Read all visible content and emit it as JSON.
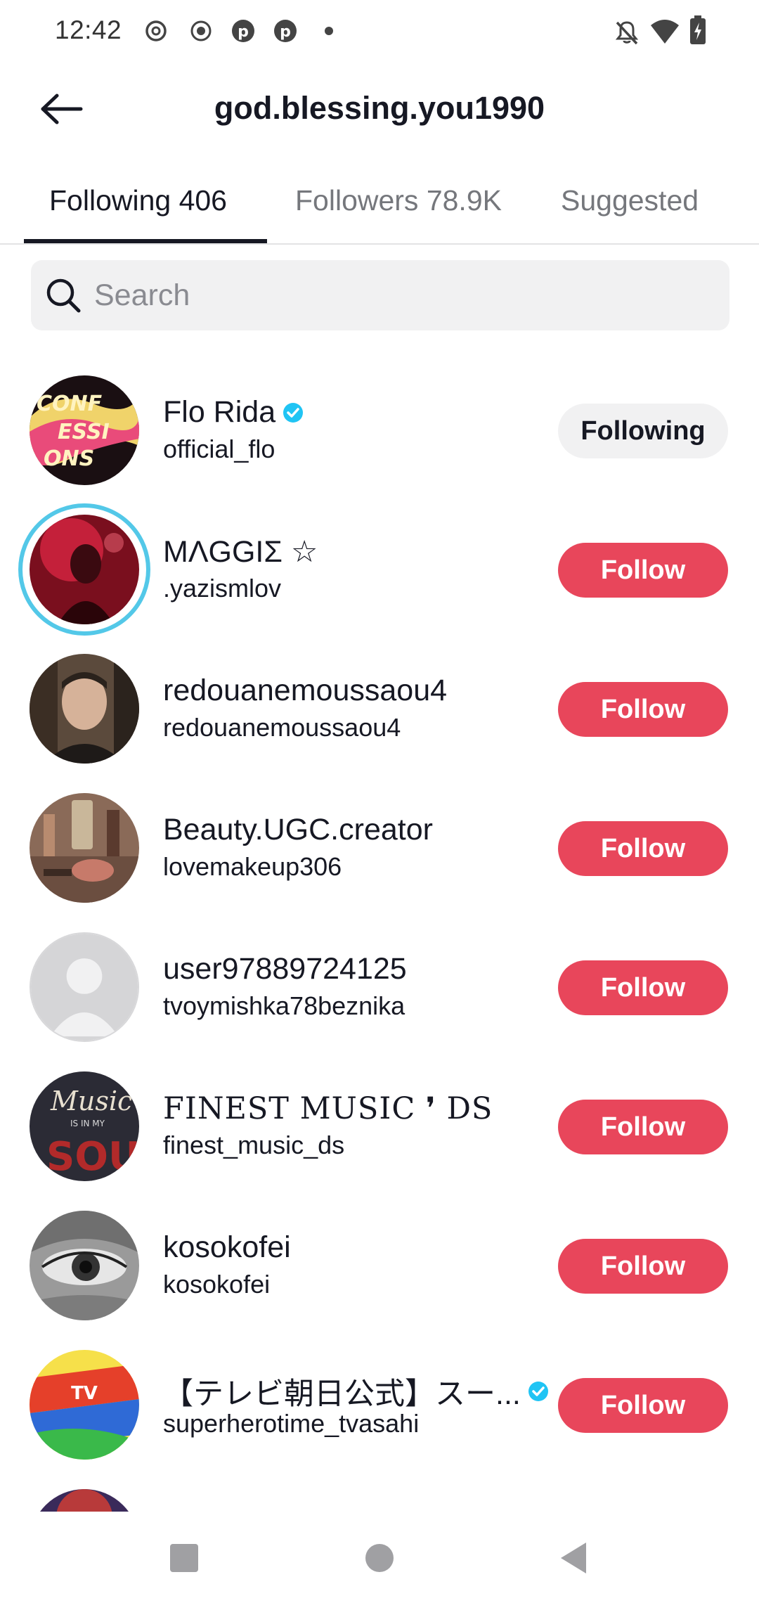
{
  "status_bar": {
    "time": "12:42"
  },
  "header": {
    "title": "god.blessing.you1990"
  },
  "tabs": [
    {
      "label": "Following 406",
      "active": true
    },
    {
      "label": "Followers 78.9K",
      "active": false
    },
    {
      "label": "Suggested",
      "active": false
    }
  ],
  "search": {
    "placeholder": "Search"
  },
  "users": [
    {
      "name": "Flo Rida",
      "handle": "official_flo",
      "verified": true,
      "button": "Following"
    },
    {
      "name": "ΜΛGGIΣ ☆",
      "handle": ".yazismlov",
      "verified": false,
      "button": "Follow"
    },
    {
      "name": "redouanemoussaou4",
      "handle": "redouanemoussaou4",
      "verified": false,
      "button": "Follow"
    },
    {
      "name": "Beauty.UGC.creator",
      "handle": "lovemakeup306",
      "verified": false,
      "button": "Follow"
    },
    {
      "name": "user97889724125",
      "handle": "tvoymishka78beznika",
      "verified": false,
      "button": "Follow"
    },
    {
      "name": "FINEST MUSIC ❜ DS",
      "handle": "finest_music_ds",
      "verified": false,
      "button": "Follow"
    },
    {
      "name": "kosokofei",
      "handle": "kosokofei",
      "verified": false,
      "button": "Follow"
    },
    {
      "name": "【テレビ朝日公式】スー...",
      "handle": "superherotime_tvasahi",
      "verified": true,
      "button": "Follow"
    }
  ],
  "colors": {
    "follow": "#e8465b",
    "following": "#f1f1f2",
    "verified": "#20c4f4",
    "story_ring": "#53c8e8"
  }
}
